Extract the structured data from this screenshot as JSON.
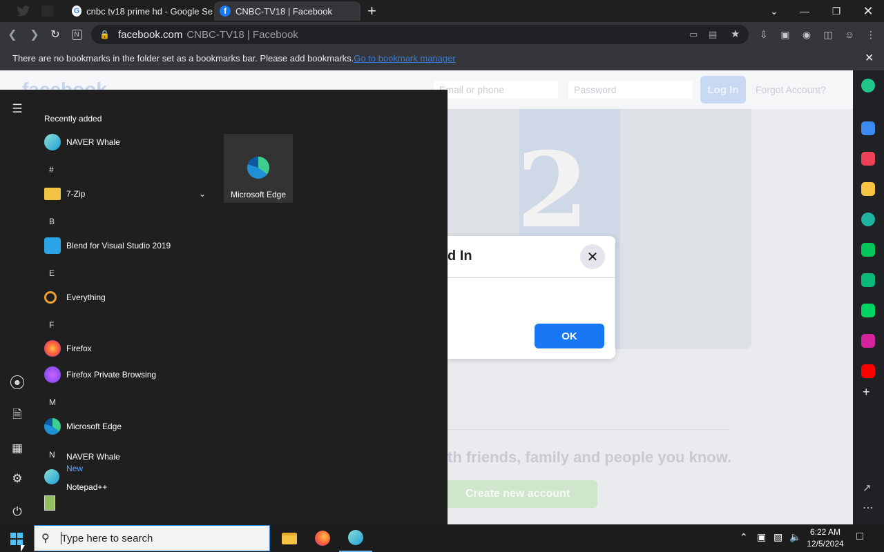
{
  "browser": {
    "tabs": [
      {
        "title": "cnbc tv18 prime hd - Google Se",
        "active": false
      },
      {
        "title": "CNBC-TV18 | Facebook",
        "active": true
      }
    ],
    "new_tab": "+",
    "omnibox": {
      "host": "facebook.com",
      "title": "CNBC-TV18 | Facebook"
    },
    "bookmarks_bar": {
      "message": "There are no bookmarks in the folder set as a bookmarks bar. Please add bookmarks.",
      "link": "Go to bookmark manager"
    }
  },
  "facebook": {
    "email_placeholder": "Email or phone",
    "password_placeholder": "Password",
    "login_label": "Log In",
    "forgot_label": "Forgot Account?",
    "tagline": "th friends, family and people you know.",
    "create_label": "Create new account",
    "dialog": {
      "title": "d In",
      "ok_label": "OK"
    }
  },
  "start_menu": {
    "recently_added": "Recently added",
    "tile_label": "Microsoft Edge",
    "sections": {
      "hash": "#",
      "b": "B",
      "e": "E",
      "f": "F",
      "m": "M",
      "n": "N"
    },
    "items": {
      "whale_recent": "NAVER Whale",
      "zip": "7-Zip",
      "blend": "Blend for Visual Studio 2019",
      "everything": "Everything",
      "firefox": "Firefox",
      "firefox_private": "Firefox Private Browsing",
      "edge": "Microsoft Edge",
      "whale": "NAVER Whale",
      "whale_new": "New",
      "notepad": "Notepad++"
    }
  },
  "taskbar": {
    "search_placeholder": "Type here to search",
    "time": "6:22 AM",
    "date": "12/5/2024"
  },
  "colors": {
    "fb_blue": "#1877f2",
    "accent_link": "#3c7bd6"
  }
}
